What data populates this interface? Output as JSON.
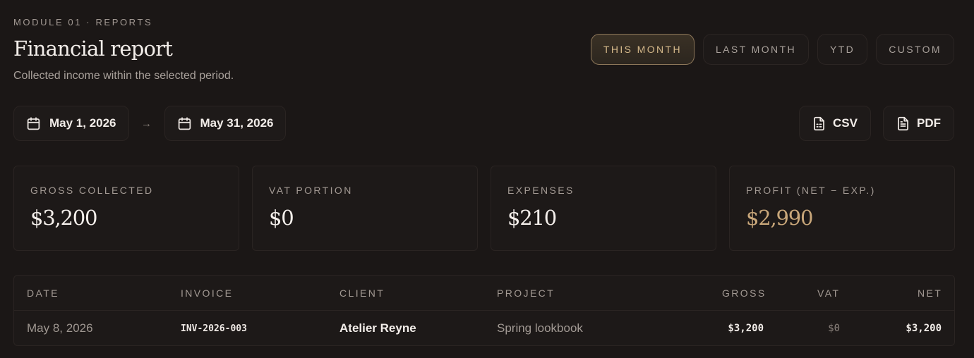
{
  "header": {
    "eyebrow": "MODULE 01 · REPORTS",
    "title": "Financial report",
    "subtitle": "Collected income within the selected period."
  },
  "period_tabs": [
    {
      "label": "THIS MONTH",
      "active": true
    },
    {
      "label": "LAST MONTH",
      "active": false
    },
    {
      "label": "YTD",
      "active": false
    },
    {
      "label": "CUSTOM",
      "active": false
    }
  ],
  "date_range": {
    "from": "May 1, 2026",
    "arrow": "→",
    "to": "May 31, 2026"
  },
  "export": {
    "csv_label": "CSV",
    "pdf_label": "PDF"
  },
  "stats": [
    {
      "label": "GROSS COLLECTED",
      "value": "$3,200"
    },
    {
      "label": "VAT PORTION",
      "value": "$0"
    },
    {
      "label": "EXPENSES",
      "value": "$210"
    },
    {
      "label": "PROFIT (NET − EXP.)",
      "value": "$2,990"
    }
  ],
  "table": {
    "columns": [
      "DATE",
      "INVOICE",
      "CLIENT",
      "PROJECT",
      "GROSS",
      "VAT",
      "NET"
    ],
    "rows": [
      {
        "date": "May 8, 2026",
        "invoice": "INV-2026-003",
        "client": "Atelier Reyne",
        "project": "Spring lookbook",
        "gross": "$3,200",
        "vat": "$0",
        "net": "$3,200"
      }
    ]
  },
  "colors": {
    "background": "#1b1716",
    "accent": "#c9a77a",
    "accent_border": "#8c7659"
  }
}
